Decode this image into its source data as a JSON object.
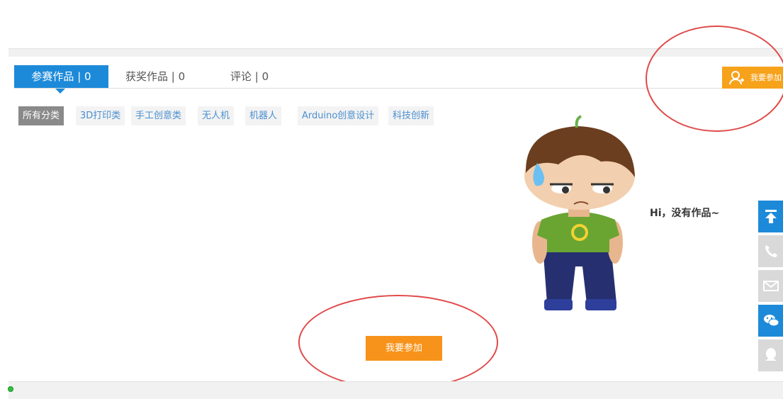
{
  "tabs": [
    {
      "label": "参赛作品 | 0",
      "active": true
    },
    {
      "label": "获奖作品 | 0",
      "active": false
    },
    {
      "label": "评论 | 0",
      "active": false
    }
  ],
  "categories": [
    {
      "label": "所有分类",
      "active": true
    },
    {
      "label": "3D打印类",
      "active": false
    },
    {
      "label": "手工创意类",
      "active": false
    },
    {
      "label": "无人机",
      "active": false
    },
    {
      "label": "机器人",
      "active": false
    },
    {
      "label": "Arduino创意设计",
      "active": false
    },
    {
      "label": "科技创新",
      "active": false
    }
  ],
  "join_top": {
    "label": "我要参加",
    "icon": "add-user-icon"
  },
  "empty": {
    "message": "Hi，没有作品~"
  },
  "join_bottom": {
    "label": "我要参加"
  },
  "float_bar": [
    {
      "icon": "back-to-top-icon",
      "color": "#1d8ad9"
    },
    {
      "icon": "phone-icon",
      "color": "#d9d9d9"
    },
    {
      "icon": "mail-icon",
      "color": "#d9d9d9"
    },
    {
      "icon": "wechat-icon",
      "color": "#1d8ad9"
    },
    {
      "icon": "qq-icon",
      "color": "#d9d9d9"
    }
  ],
  "colors": {
    "primary": "#1d8ad9",
    "accent": "#f7a21b",
    "annotation": "#e04a4a"
  }
}
